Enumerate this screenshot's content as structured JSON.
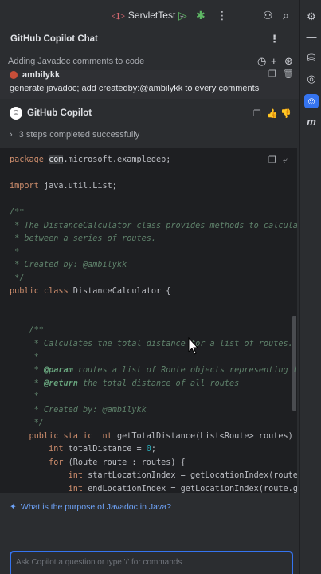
{
  "toolbar": {
    "run_config": "ServletTest"
  },
  "panel": {
    "title": "GitHub Copilot Chat",
    "session_title": "Adding Javadoc comments to code"
  },
  "user_message": {
    "name": "ambilykk",
    "text": "generate javadoc; add createdby:@ambilykk to every comments"
  },
  "assistant": {
    "name": "GitHub Copilot",
    "steps_label": "3 steps completed successfully"
  },
  "code_lines": [
    {
      "parts": [
        {
          "t": "kw",
          "v": "package "
        },
        {
          "t": "hl",
          "v": "com"
        },
        {
          "t": "plain",
          "v": ".microsoft.exampledep;"
        }
      ]
    },
    {
      "parts": []
    },
    {
      "parts": [
        {
          "t": "kw",
          "v": "import "
        },
        {
          "t": "plain",
          "v": "java.util.List;"
        }
      ]
    },
    {
      "parts": []
    },
    {
      "parts": [
        {
          "t": "cmt",
          "v": "/**"
        }
      ]
    },
    {
      "parts": [
        {
          "t": "cmt",
          "v": " * The DistanceCalculator class provides methods to calculate t"
        }
      ]
    },
    {
      "parts": [
        {
          "t": "cmt",
          "v": " * between a series of routes."
        }
      ]
    },
    {
      "parts": [
        {
          "t": "cmt",
          "v": " *"
        }
      ]
    },
    {
      "parts": [
        {
          "t": "cmt",
          "v": " * Created by: @ambilykk"
        }
      ]
    },
    {
      "parts": [
        {
          "t": "cmt",
          "v": " */"
        }
      ]
    },
    {
      "parts": [
        {
          "t": "kw",
          "v": "public class "
        },
        {
          "t": "plain",
          "v": "DistanceCalculator {"
        }
      ]
    },
    {
      "parts": []
    },
    {
      "parts": []
    },
    {
      "parts": [
        {
          "t": "cmt",
          "v": "    /**"
        }
      ]
    },
    {
      "parts": [
        {
          "t": "cmt",
          "v": "     * Calculates the total distance for a list of routes."
        }
      ]
    },
    {
      "parts": [
        {
          "t": "cmt",
          "v": "     *"
        }
      ]
    },
    {
      "parts": [
        {
          "t": "cmt",
          "v": "     * "
        },
        {
          "t": "tag",
          "v": "@param"
        },
        {
          "t": "cmt",
          "v": " routes a list of Route objects representing the"
        }
      ]
    },
    {
      "parts": [
        {
          "t": "cmt",
          "v": "     * "
        },
        {
          "t": "tag",
          "v": "@return"
        },
        {
          "t": "cmt",
          "v": " the total distance of all routes"
        }
      ]
    },
    {
      "parts": [
        {
          "t": "cmt",
          "v": "     *"
        }
      ]
    },
    {
      "parts": [
        {
          "t": "cmt",
          "v": "     * Created by: @ambilykk"
        }
      ]
    },
    {
      "parts": [
        {
          "t": "cmt",
          "v": "     */"
        }
      ]
    },
    {
      "parts": [
        {
          "t": "kw",
          "v": "    public static int "
        },
        {
          "t": "plain",
          "v": "getTotalDistance(List<Route> routes) {"
        }
      ]
    },
    {
      "parts": [
        {
          "t": "kw",
          "v": "        int "
        },
        {
          "t": "plain",
          "v": "totalDistance = "
        },
        {
          "t": "num",
          "v": "0"
        },
        {
          "t": "plain",
          "v": ";"
        }
      ]
    },
    {
      "parts": [
        {
          "t": "kw",
          "v": "        for "
        },
        {
          "t": "plain",
          "v": "(Route route : routes) {"
        }
      ]
    },
    {
      "parts": [
        {
          "t": "kw",
          "v": "            int "
        },
        {
          "t": "plain",
          "v": "startLocationIndex = getLocationIndex(route.get"
        }
      ]
    },
    {
      "parts": [
        {
          "t": "kw",
          "v": "            int "
        },
        {
          "t": "plain",
          "v": "endLocationIndex = getLocationIndex(route.getD"
        }
      ]
    }
  ],
  "suggestion": "What is the purpose of Javadoc in Java?",
  "input": {
    "placeholder": "Ask Copilot a question or type '/' for commands",
    "value": ""
  },
  "colors": {
    "accent": "#3574f0",
    "keyword": "#cf8e6d",
    "comment": "#5f826b"
  }
}
